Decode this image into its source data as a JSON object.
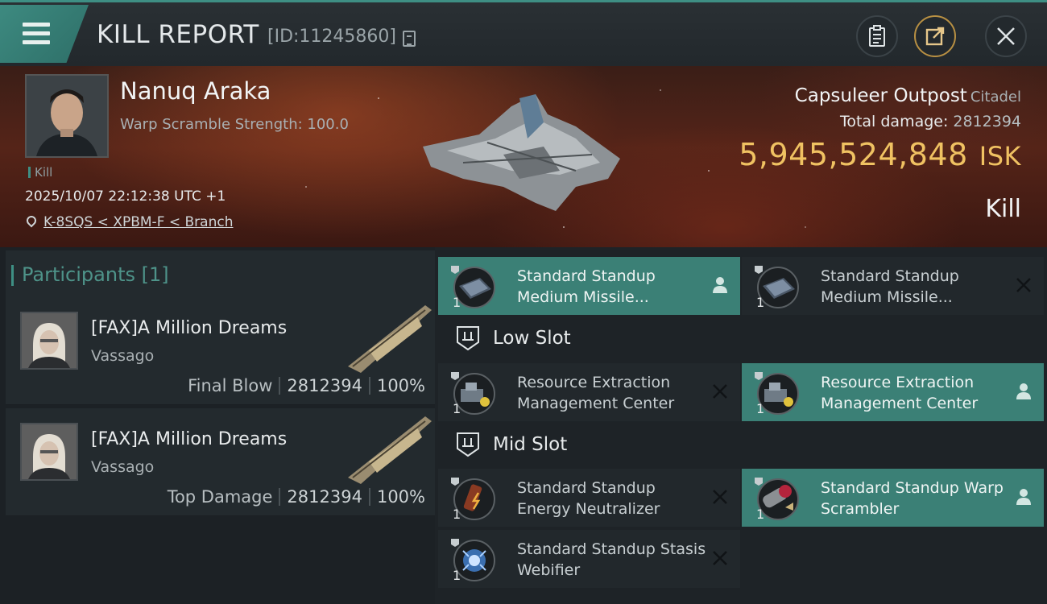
{
  "header": {
    "title": "KILL REPORT",
    "report_id": "[ID:11245860]",
    "icons": [
      "menu-icon",
      "copy-icon",
      "clipboard-icon",
      "share-icon",
      "close-icon"
    ]
  },
  "victim": {
    "pilot_name": "Nanuq Araka",
    "subtitle": "Warp Scramble Strength: 100.0",
    "tag": "Kill",
    "timestamp": "2025/10/07 22:12:38 UTC +1",
    "location": "K-8SQS < XPBM-F < Branch",
    "ship_name": "Capsuleer Outpost",
    "ship_class": "Citadel",
    "total_damage_label": "Total damage:",
    "total_damage_value": "2812394",
    "isk_value": "5,945,524,848",
    "isk_unit": "ISK",
    "result": "Kill"
  },
  "participants": {
    "title": "Participants [1]",
    "rows": [
      {
        "name": "[FAX]A Million Dreams",
        "ship": "Vassago",
        "role": "Final Blow",
        "damage": "2812394",
        "percent": "100%"
      },
      {
        "name": "[FAX]A Million Dreams",
        "ship": "Vassago",
        "role": "Top Damage",
        "damage": "2812394",
        "percent": "100%"
      }
    ]
  },
  "fitting": {
    "top_items": [
      {
        "name": "Standard Standup Medium Missile...",
        "qty": "1",
        "status": "dropped"
      },
      {
        "name": "Standard Standup Medium Missile...",
        "qty": "1",
        "status": "destroyed"
      }
    ],
    "low_slot": {
      "label": "Low Slot",
      "items": [
        {
          "name": "Resource Extraction Management Center",
          "qty": "1",
          "status": "destroyed"
        },
        {
          "name": "Resource Extraction Management Center",
          "qty": "1",
          "status": "dropped"
        }
      ]
    },
    "mid_slot": {
      "label": "Mid Slot",
      "items": [
        {
          "name": "Standard Standup Energy Neutralizer",
          "qty": "1",
          "status": "destroyed"
        },
        {
          "name": "Standard Standup Warp Scrambler",
          "qty": "1",
          "status": "dropped"
        },
        {
          "name": "Standard Standup Stasis Webifier",
          "qty": "1",
          "status": "destroyed"
        }
      ]
    }
  },
  "colors": {
    "accent": "#3e8f84",
    "dropped_bg": "#3b8076",
    "isk": "#f0c262",
    "banner": "#552418"
  }
}
